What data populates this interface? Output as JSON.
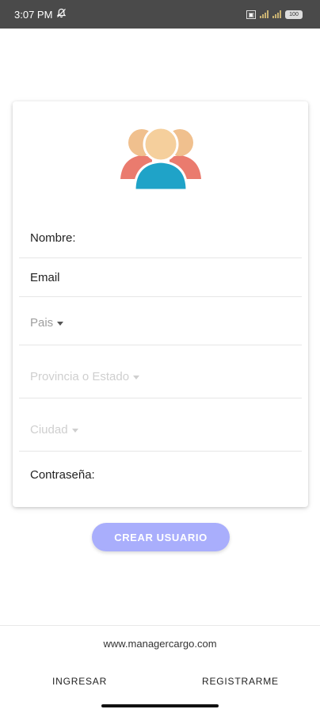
{
  "status_bar": {
    "time": "3:07 PM",
    "battery": "100"
  },
  "form": {
    "fields": {
      "nombre": "Nombre:",
      "email": "Email",
      "pais": "Pais",
      "provincia": "Provincia o Estado",
      "ciudad": "Ciudad",
      "contrasena": "Contraseña:"
    },
    "submit_label": "CREAR USUARIO"
  },
  "footer": {
    "url": "www.managercargo.com",
    "login_label": "INGRESAR",
    "register_label": "REGISTRARME"
  },
  "colors": {
    "accent_button": "#a9aefc",
    "status_bar": "#4a4a4a",
    "avatar_center_shirt": "#1fa3c8",
    "avatar_side_shirt": "#ea7b6e",
    "avatar_skin": "#f5cf9c"
  },
  "icons": {
    "header": "users-group-icon",
    "status": [
      "mute-icon",
      "signal-icon",
      "battery-icon"
    ]
  }
}
